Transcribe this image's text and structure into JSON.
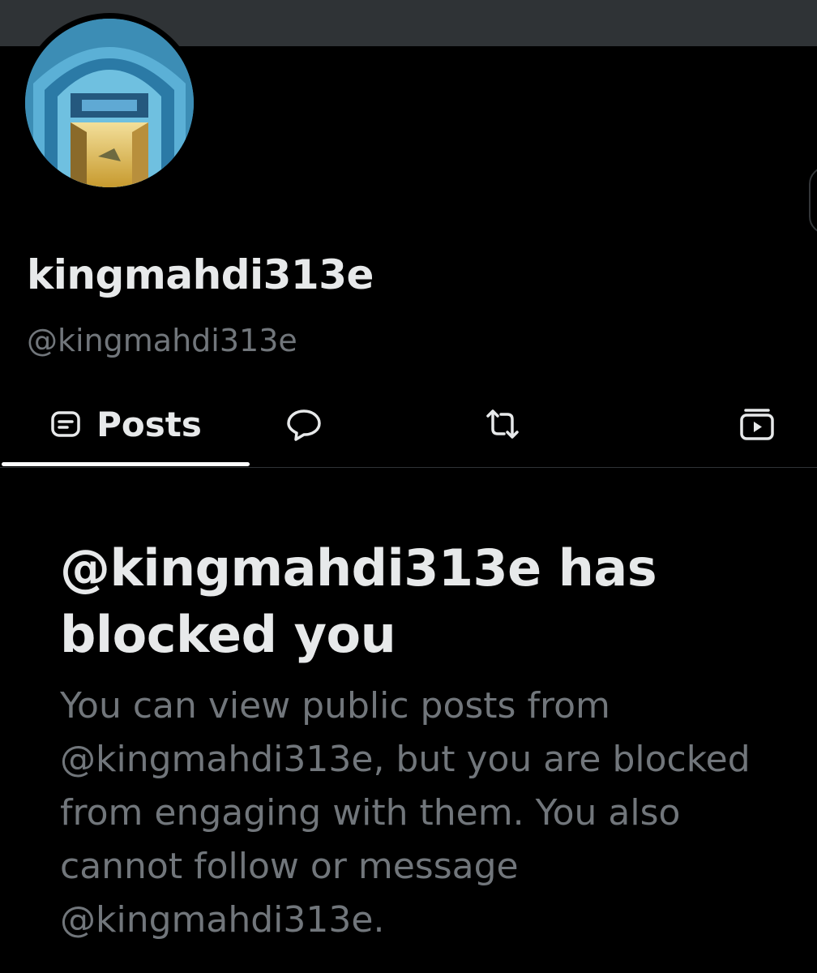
{
  "profile": {
    "display_name": "kingmahdi313e",
    "handle": "@kingmahdi313e",
    "avatar_description": "profile-picture"
  },
  "tabs": {
    "items": [
      {
        "label": "Posts",
        "icon": "document-lines-icon",
        "selected": true
      },
      {
        "label": "",
        "icon": "speech-bubble-icon",
        "selected": false
      },
      {
        "label": "",
        "icon": "repost-arrows-icon",
        "selected": false
      },
      {
        "label": "",
        "icon": "media-play-icon",
        "selected": false
      }
    ]
  },
  "blocked": {
    "title": "@kingmahdi313e has blocked you",
    "body": "You can view public posts from @kingmahdi313e, but you are blocked from engaging with them. You also cannot follow or message @kingmahdi313e."
  },
  "colors": {
    "background": "#000000",
    "banner": "#2f3336",
    "primary_text": "#e7e9ea",
    "secondary_text": "#71767b",
    "tab_indicator": "#ffffff"
  }
}
